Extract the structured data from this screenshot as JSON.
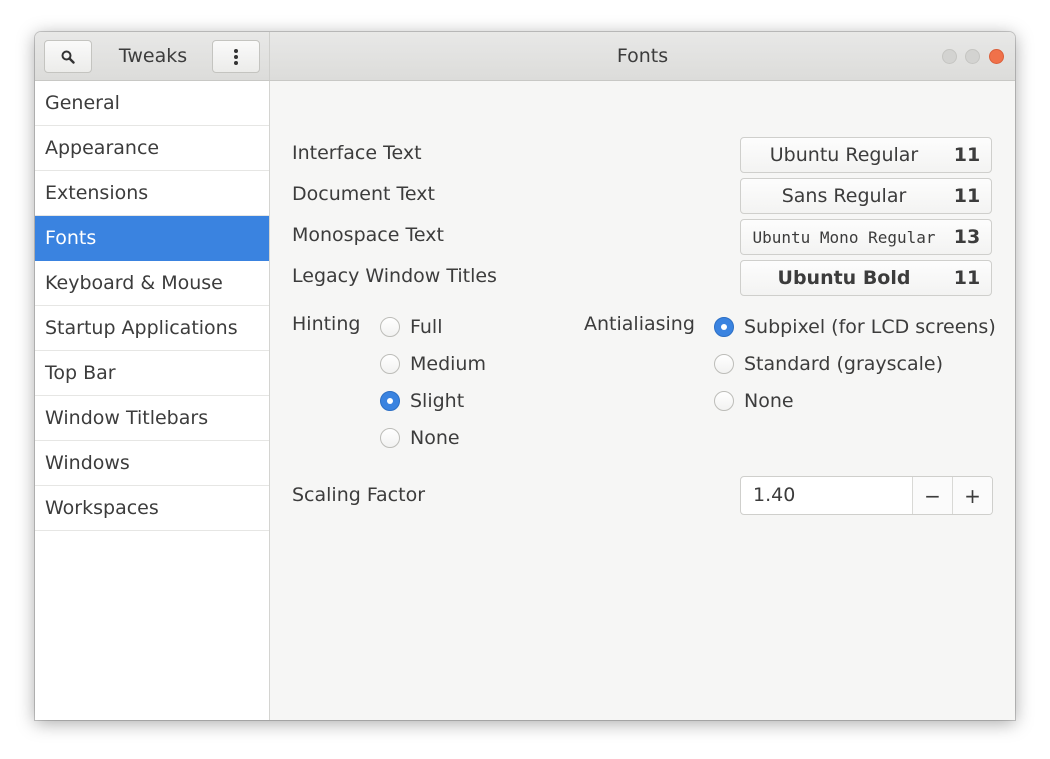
{
  "header": {
    "app_title": "Tweaks",
    "page_title": "Fonts",
    "search_icon": "search-icon",
    "menu_icon": "vertical-ellipsis-icon",
    "close_color": "#f0714a"
  },
  "sidebar": {
    "accent_color": "#3a83e0",
    "items": [
      {
        "label": "General"
      },
      {
        "label": "Appearance"
      },
      {
        "label": "Extensions"
      },
      {
        "label": "Fonts",
        "selected": true
      },
      {
        "label": "Keyboard & Mouse"
      },
      {
        "label": "Startup Applications"
      },
      {
        "label": "Top Bar"
      },
      {
        "label": "Window Titlebars"
      },
      {
        "label": "Windows"
      },
      {
        "label": "Workspaces"
      }
    ]
  },
  "fonts": {
    "interface": {
      "label": "Interface Text",
      "name": "Ubuntu Regular",
      "size": "11"
    },
    "document": {
      "label": "Document Text",
      "name": "Sans Regular",
      "size": "11"
    },
    "monospace": {
      "label": "Monospace Text",
      "name": "Ubuntu Mono Regular",
      "size": "13"
    },
    "legacy": {
      "label": "Legacy Window Titles",
      "name": "Ubuntu Bold",
      "size": "11"
    }
  },
  "hinting": {
    "label": "Hinting",
    "options": [
      "Full",
      "Medium",
      "Slight",
      "None"
    ],
    "selected": "Slight"
  },
  "antialiasing": {
    "label": "Antialiasing",
    "options": [
      "Subpixel (for LCD screens)",
      "Standard (grayscale)",
      "None"
    ],
    "selected": "Subpixel (for LCD screens)"
  },
  "scaling": {
    "label": "Scaling Factor",
    "value": "1.40",
    "decrement": "−",
    "increment": "+"
  }
}
